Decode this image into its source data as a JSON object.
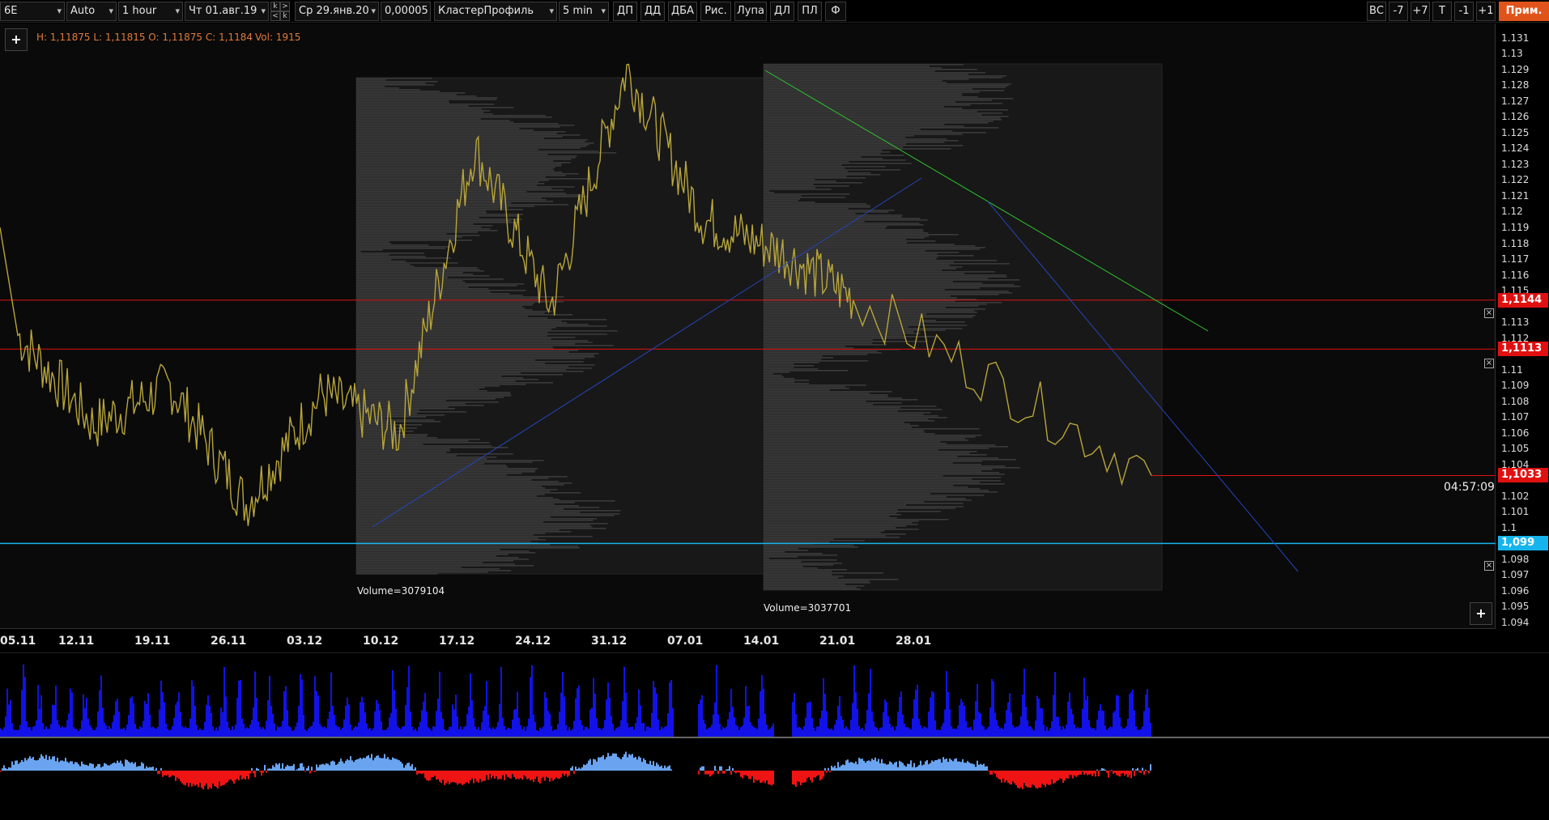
{
  "toolbar": {
    "symbol": "6E",
    "scale": "Auto",
    "timeframe": "1 hour",
    "date_from": "Чт 01.авг.19",
    "nav_up": "k",
    "nav_up2": ">",
    "nav_down": "<",
    "nav_down2": "k",
    "date_to": "Ср 29.янв.20",
    "tick_size": "0,00005",
    "profile_type": "КластерПрофиль",
    "profile_period": "5 min",
    "buttons": [
      "ДП",
      "ДД",
      "ДБА",
      "Рис.",
      "Лупа",
      "ДЛ",
      "ПЛ",
      "Ф"
    ],
    "right_buttons": [
      "ВС",
      "-7",
      "+7",
      "T",
      "-1",
      "+1"
    ],
    "apply_button": "Прим."
  },
  "header": {
    "ohlc": "H: 1,11875 L: 1,11815 O: 1,11875 C: 1,1184",
    "volume": "Vol: 1915",
    "plus": "+"
  },
  "profiles": [
    {
      "label": "Volume=3079104"
    },
    {
      "label": "Volume=3037701"
    }
  ],
  "timer": "04:57:09",
  "price_axis": {
    "labels": [
      "1.131",
      "1.13",
      "1.129",
      "1.128",
      "1.127",
      "1.126",
      "1.125",
      "1.124",
      "1.123",
      "1.122",
      "1.121",
      "1.12",
      "1.119",
      "1.118",
      "1.117",
      "1.116",
      "1.115",
      "1.113",
      "1.112",
      "1.11",
      "1.109",
      "1.108",
      "1.107",
      "1.106",
      "1.105",
      "1.104",
      "1.102",
      "1.101",
      "1.1",
      "1.098",
      "1.097",
      "1.096",
      "1.095",
      "1.094"
    ],
    "tags": [
      {
        "value": "1,1144",
        "color": "#e01010"
      },
      {
        "value": "1,1113",
        "color": "#e01010"
      },
      {
        "value": "1,1033",
        "color": "#e01010"
      },
      {
        "value": "1,099",
        "color": "#16b4ec"
      }
    ]
  },
  "date_axis": [
    "05.11",
    "12.11",
    "19.11",
    "26.11",
    "03.12",
    "10.12",
    "17.12",
    "24.12",
    "31.12",
    "07.01",
    "14.01",
    "21.01",
    "28.01"
  ],
  "colors": {
    "price_line": "#b8a53a",
    "red_level": "#e01010",
    "cyan_level": "#16b4ec",
    "trend_green": "#2dc82d",
    "trend_blue": "#2446b8",
    "volume_bar": "#1212e8",
    "delta_pos": "#6aa4f0",
    "delta_neg": "#ee1414",
    "profile_fill": "#3a3a3a"
  },
  "chart_data": {
    "type": "line",
    "x": [
      "05.11",
      "12.11",
      "19.11",
      "26.11",
      "03.12",
      "10.12",
      "17.12",
      "24.12",
      "31.12",
      "07.01",
      "14.01",
      "21.01",
      "28.01"
    ],
    "series": [
      {
        "values": [
          1.1122,
          1.1065,
          1.109,
          1.1015,
          1.1085,
          1.106,
          1.124,
          1.114,
          1.129,
          1.1195,
          1.1175,
          1.1145,
          1.1033
        ]
      }
    ],
    "ylim": [
      1.094,
      1.1315
    ]
  }
}
